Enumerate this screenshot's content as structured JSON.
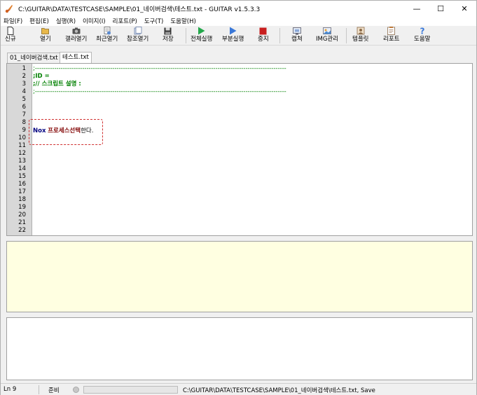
{
  "window": {
    "title": "C:\\GUITAR\\DATA\\TESTCASE\\SAMPLE\\01_네이버검색\\테스트.txt - GUITAR v1.5.3.3",
    "minimize_glyph": "—",
    "maximize_glyph": "☐",
    "close_glyph": "✕"
  },
  "menu": [
    "파일(F)",
    "편집(E)",
    "실행(R)",
    "이미지(I)",
    "리포트(P)",
    "도구(T)",
    "도움말(H)"
  ],
  "toolbar": {
    "new": "신규",
    "open": "열기",
    "gallery_open": "갤러열기",
    "recent_open": "최근열기",
    "ref_open": "참조열기",
    "save": "저장",
    "run_all": "전체실행",
    "run_part": "부분실행",
    "stop": "중지",
    "capture": "캡쳐",
    "img_manage": "IMG관리",
    "template": "템플릿",
    "report": "리포트",
    "help": "도움말"
  },
  "tabs": [
    "01_네이버검색.txt",
    "테스트.txt"
  ],
  "editor": {
    "line_numbers": [
      "1",
      "2",
      "3",
      "4",
      "5",
      "6",
      "7",
      "8",
      "9",
      "10",
      "11",
      "12",
      "13",
      "14",
      "15",
      "16",
      "17",
      "18",
      "19",
      "20",
      "21",
      "22"
    ],
    "line1": ";---------------------------------------------------------------------------------------------------------------------",
    "line2": ";ID =",
    "line3": ";// 스크립트 설명 :",
    "line4": ";---------------------------------------------------------------------------------------------------------------------",
    "line9_kw1": "Nox",
    "line9_kw2": "프로세스선택",
    "line9_text": "한다."
  },
  "status": {
    "line": "Ln 9",
    "state": "준비",
    "path": "C:\\GUITAR\\DATA\\TESTCASE\\SAMPLE\\01_네이버검색\\테스트.txt, Save"
  },
  "colors": {
    "comment": "#008000",
    "keyword_object": "#000080",
    "keyword_action": "#800000",
    "highlight_border": "#d03030",
    "output_panel": "#ffffe1"
  }
}
